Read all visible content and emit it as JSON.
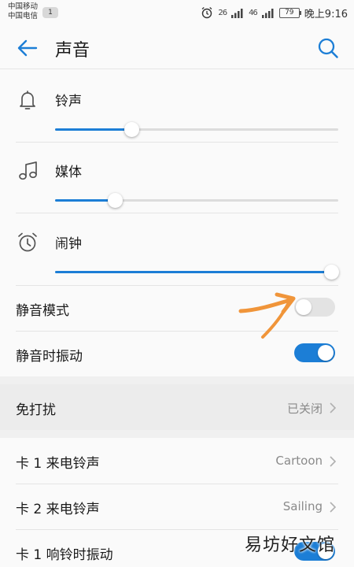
{
  "status_bar": {
    "carrier1": "中国移动",
    "carrier2": "中国电信",
    "sim_badge": "1",
    "net1": "26",
    "net2": "46",
    "battery": "79",
    "time": "晚上9:16"
  },
  "header": {
    "title": "声音"
  },
  "volumes": {
    "ringtone": {
      "label": "铃声",
      "level_percent": 27
    },
    "media": {
      "label": "媒体",
      "level_percent": 21
    },
    "alarm": {
      "label": "闹钟",
      "level_percent": 100
    }
  },
  "toggles": {
    "silent_mode": {
      "label": "静音模式",
      "on": false
    },
    "vibrate_silent": {
      "label": "静音时振动",
      "on": true
    }
  },
  "dnd": {
    "label": "免打扰",
    "value": "已关闭"
  },
  "sim1_ringtone": {
    "label": "卡 1 来电铃声",
    "value": "Cartoon"
  },
  "sim2_ringtone": {
    "label": "卡 2 来电铃声",
    "value": "Sailing"
  },
  "sim1_vibrate": {
    "label": "卡 1 响铃时振动",
    "on": true
  },
  "watermark": "易坊好文馆",
  "colors": {
    "accent": "#1c7ed6",
    "annotation": "#f0953a"
  }
}
